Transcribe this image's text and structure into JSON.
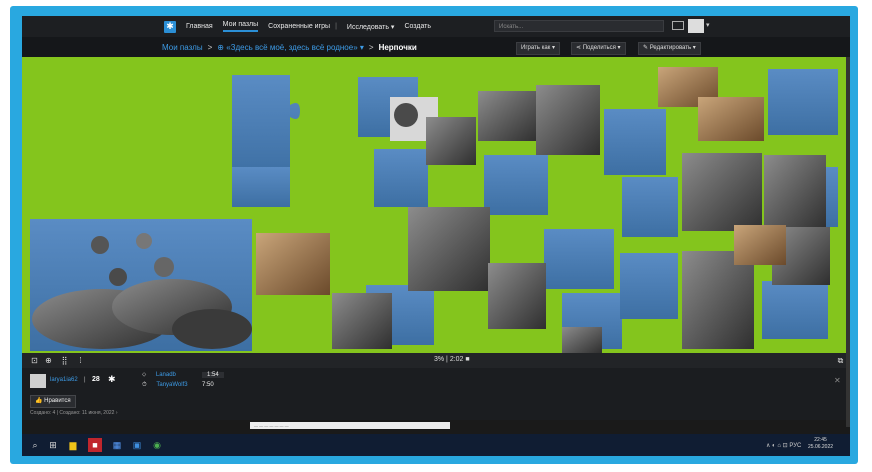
{
  "nav": {
    "logo_glyph": "✱",
    "items": [
      "Главная",
      "Мои пазлы",
      "Сохраненные игры",
      "Исследовать ▾",
      "Создать"
    ],
    "search_placeholder": "Искать...",
    "caret": "▾"
  },
  "breadcrumb": {
    "root": "Мои пазлы",
    "sep1": ">",
    "folder": "⊕ «Здесь всё моё, здесь всё родное» ▾",
    "sep2": ">",
    "current": "Нерпочки"
  },
  "toolbar": {
    "play": "Играть как ▾",
    "share": "⋖ Поделиться ▾",
    "edit": "✎ Редактировать ▾"
  },
  "controls": {
    "progress": "3%  |  2:02 ■",
    "icon_labels": [
      "⊡",
      "⊕",
      "⣿",
      "⁞"
    ],
    "fullscreen": "⧉"
  },
  "info": {
    "username": "larya1ia62",
    "score": "28",
    "stats": [
      {
        "icon": "⬦",
        "label": "Lanadb",
        "value": "1:54"
      },
      {
        "icon": "⏱",
        "label": "TanyaWolf3",
        "value": "7:50"
      }
    ],
    "like_label": "👍 Нравится",
    "saved_text": "Создано: 4 | Создано: 11 июня, 2022 ›",
    "close_glyph": "✕",
    "bottom_strip": "— — — — — — —"
  },
  "taskbar": {
    "icons": [
      "⌕",
      "⊞",
      "▆",
      "■",
      "▦",
      "▣",
      "◉"
    ],
    "tray": "∧ ◐ ⌂ ⊡ РУС",
    "time": "22:45",
    "date": "25.06.2022"
  },
  "colors": {
    "frame": "#29a8e0",
    "board": "#84c51d",
    "water": "#4c7fb3",
    "accent": "#2b8fd6"
  }
}
